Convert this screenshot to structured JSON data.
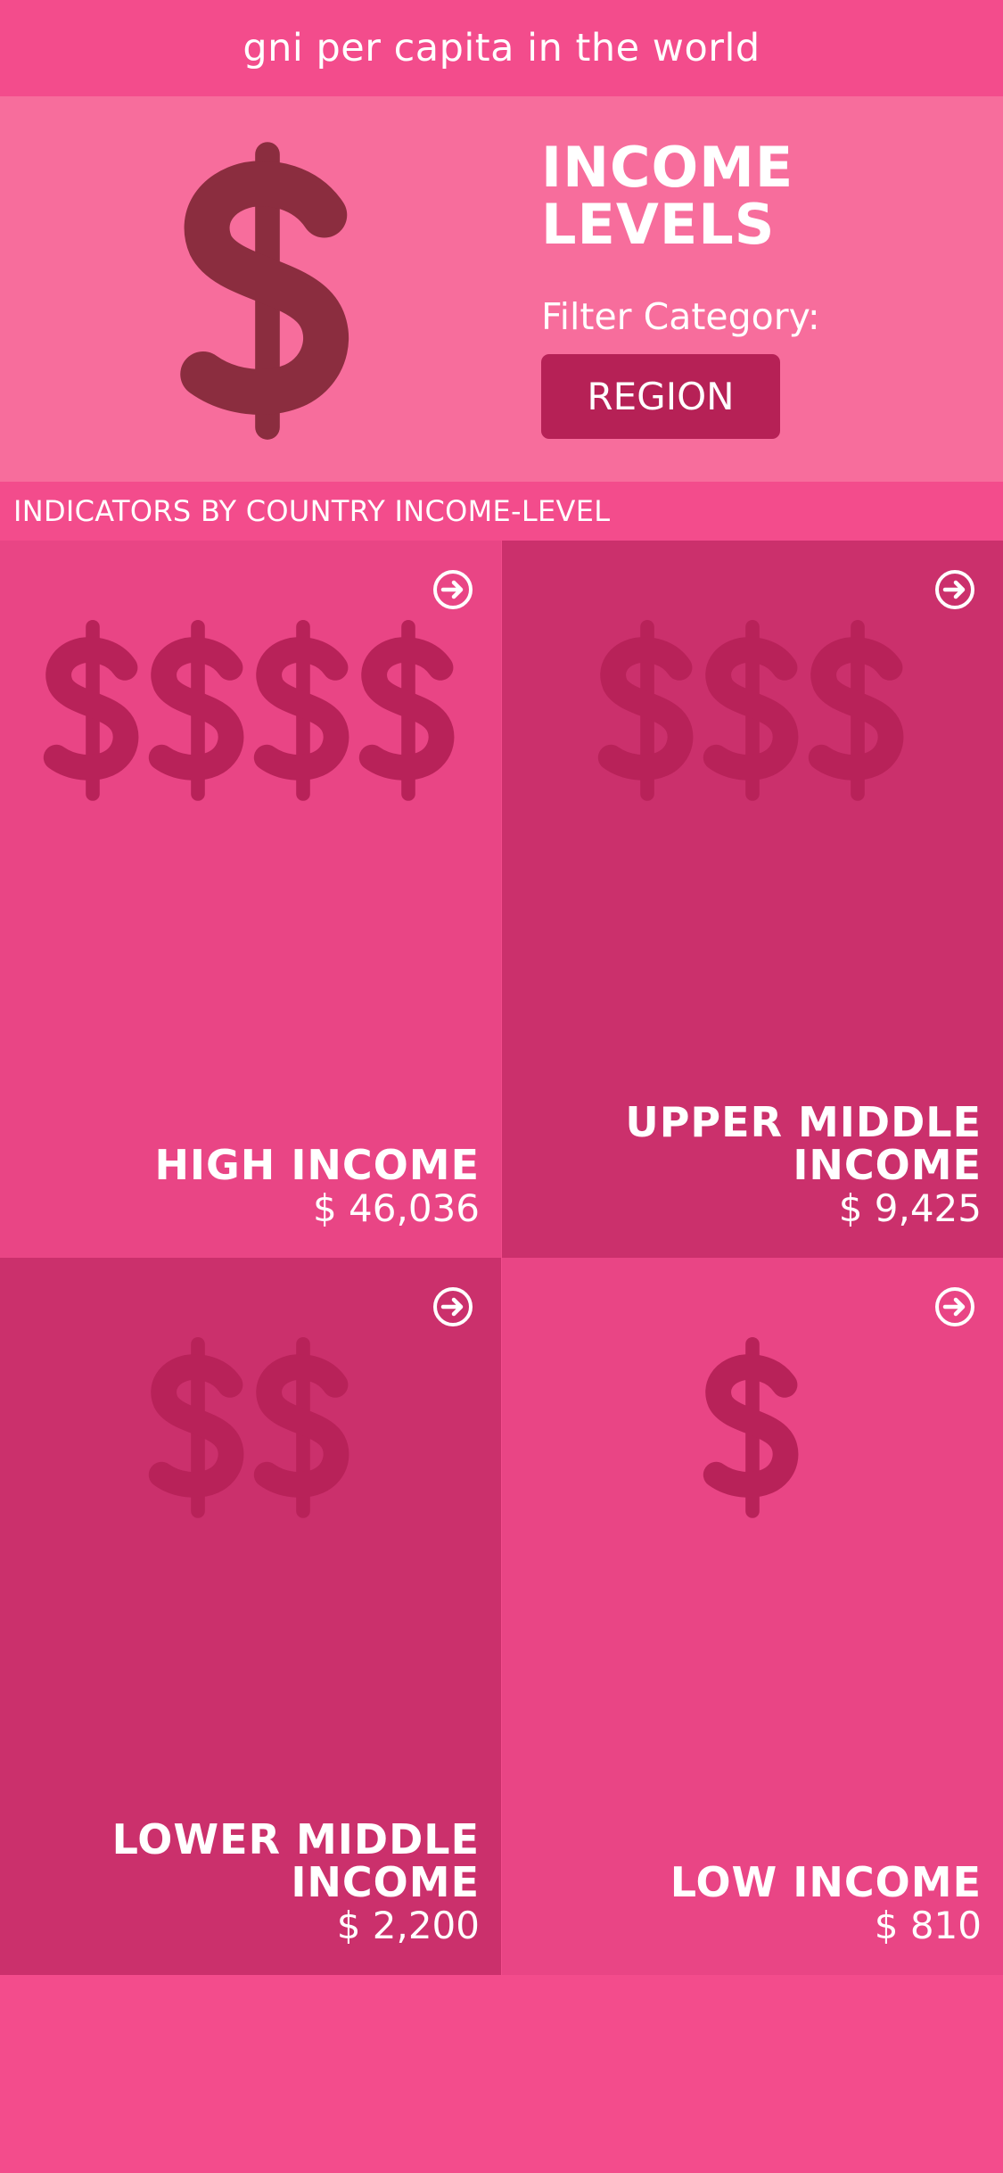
{
  "header": {
    "title": "gni per capita in the world"
  },
  "hero": {
    "heading_line1": "INCOME",
    "heading_line2": "LEVELS",
    "filter_label": "Filter Category:",
    "filter_button": "REGION",
    "icon": "dollar-icon"
  },
  "section": {
    "heading": "INDICATORS BY COUNTRY INCOME-LEVEL"
  },
  "colors": {
    "primary": "#f34c8c",
    "hero_bg": "#f76d9c",
    "hero_icon": "#8b2d3f",
    "button": "#b62156",
    "tile_light": "#e94585",
    "tile_dark": "#cb306c",
    "tile_icon": "#b82259"
  },
  "tiles": [
    {
      "name": "HIGH INCOME",
      "value": "$ 46,036",
      "dollar_count": 4,
      "icon": "arrow-circle-right-icon"
    },
    {
      "name": "UPPER MIDDLE\nINCOME",
      "value": "$ 9,425",
      "dollar_count": 3,
      "icon": "arrow-circle-right-icon"
    },
    {
      "name": "LOWER MIDDLE\nINCOME",
      "value": "$ 2,200",
      "dollar_count": 2,
      "icon": "arrow-circle-right-icon"
    },
    {
      "name": "LOW INCOME",
      "value": "$ 810",
      "dollar_count": 1,
      "icon": "arrow-circle-right-icon"
    }
  ]
}
